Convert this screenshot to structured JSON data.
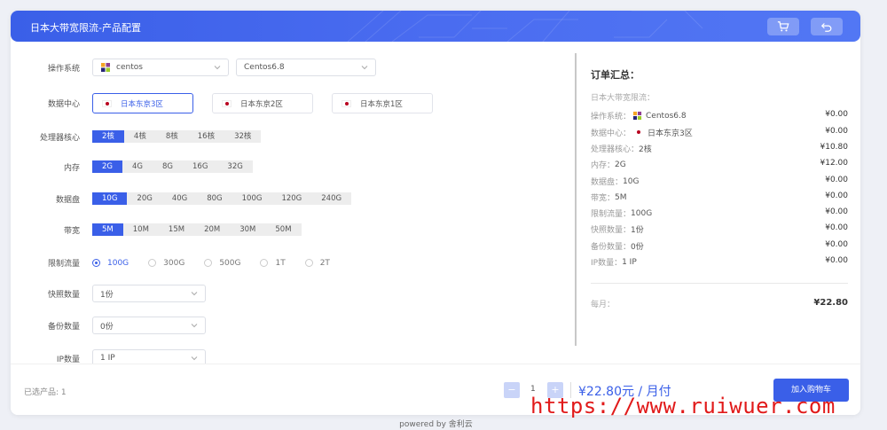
{
  "header": {
    "title": "日本大带宽限流-产品配置"
  },
  "colors": {
    "accent": "#3a5fe8",
    "watermark": "#e11a1a"
  },
  "icons": {
    "cart": "cart-icon",
    "back": "undo-icon",
    "os": "centos-logo-icon",
    "flag": "japan-flag-icon"
  },
  "form": {
    "os": {
      "label": "操作系统",
      "value": "centos",
      "version": "Centos6.8"
    },
    "datacenter": {
      "label": "数据中心",
      "options": [
        "日本东京3区",
        "日本东京2区",
        "日本东京1区"
      ],
      "selected": 0
    },
    "cpu": {
      "label": "处理器核心",
      "options": [
        "2核",
        "4核",
        "8核",
        "16核",
        "32核"
      ],
      "selected": 0
    },
    "memory": {
      "label": "内存",
      "options": [
        "2G",
        "4G",
        "8G",
        "16G",
        "32G"
      ],
      "selected": 0
    },
    "disk": {
      "label": "数据盘",
      "options": [
        "10G",
        "20G",
        "40G",
        "80G",
        "100G",
        "120G",
        "240G"
      ],
      "selected": 0
    },
    "bandwidth": {
      "label": "带宽",
      "options": [
        "5M",
        "10M",
        "15M",
        "20M",
        "30M",
        "50M"
      ],
      "selected": 0
    },
    "traffic": {
      "label": "限制流量",
      "options": [
        "100G",
        "300G",
        "500G",
        "1T",
        "2T"
      ],
      "selected": 0
    },
    "snapshot": {
      "label": "快照数量",
      "value": "1份"
    },
    "backup": {
      "label": "备份数量",
      "value": "0份"
    },
    "ip": {
      "label": "IP数量",
      "value": "1 IP"
    }
  },
  "summary": {
    "title": "订单汇总：",
    "product": "日本大带宽限流：",
    "lines": [
      {
        "key": "操作系统：",
        "value": "Centos6.8",
        "price": "¥0.00"
      },
      {
        "key": "数据中心：",
        "value": "日本东京3区",
        "price": "¥0.00"
      },
      {
        "key": "处理器核心：",
        "value": "2核",
        "price": "¥10.80"
      },
      {
        "key": "内存：",
        "value": "2G",
        "price": "¥12.00"
      },
      {
        "key": "数据盘：",
        "value": "10G",
        "price": "¥0.00"
      },
      {
        "key": "带宽：",
        "value": "5M",
        "price": "¥0.00"
      },
      {
        "key": "限制流量：",
        "value": "100G",
        "price": "¥0.00"
      },
      {
        "key": "快照数量：",
        "value": "1份",
        "price": "¥0.00"
      },
      {
        "key": "备份数量：",
        "value": "0份",
        "price": "¥0.00"
      },
      {
        "key": "IP数量：",
        "value": "1 IP",
        "price": "¥0.00"
      }
    ],
    "monthly_label": "每月：",
    "monthly_total": "¥22.80"
  },
  "footer": {
    "selected": "已选产品: 1",
    "minus": "−",
    "plus": "+",
    "quantity": "1",
    "price": "¥22.80元 / 月付",
    "add_to_cart": "加入购物车"
  },
  "powered_by": "powered by 舍利云",
  "watermark": "https://www.ruiwuer.com"
}
